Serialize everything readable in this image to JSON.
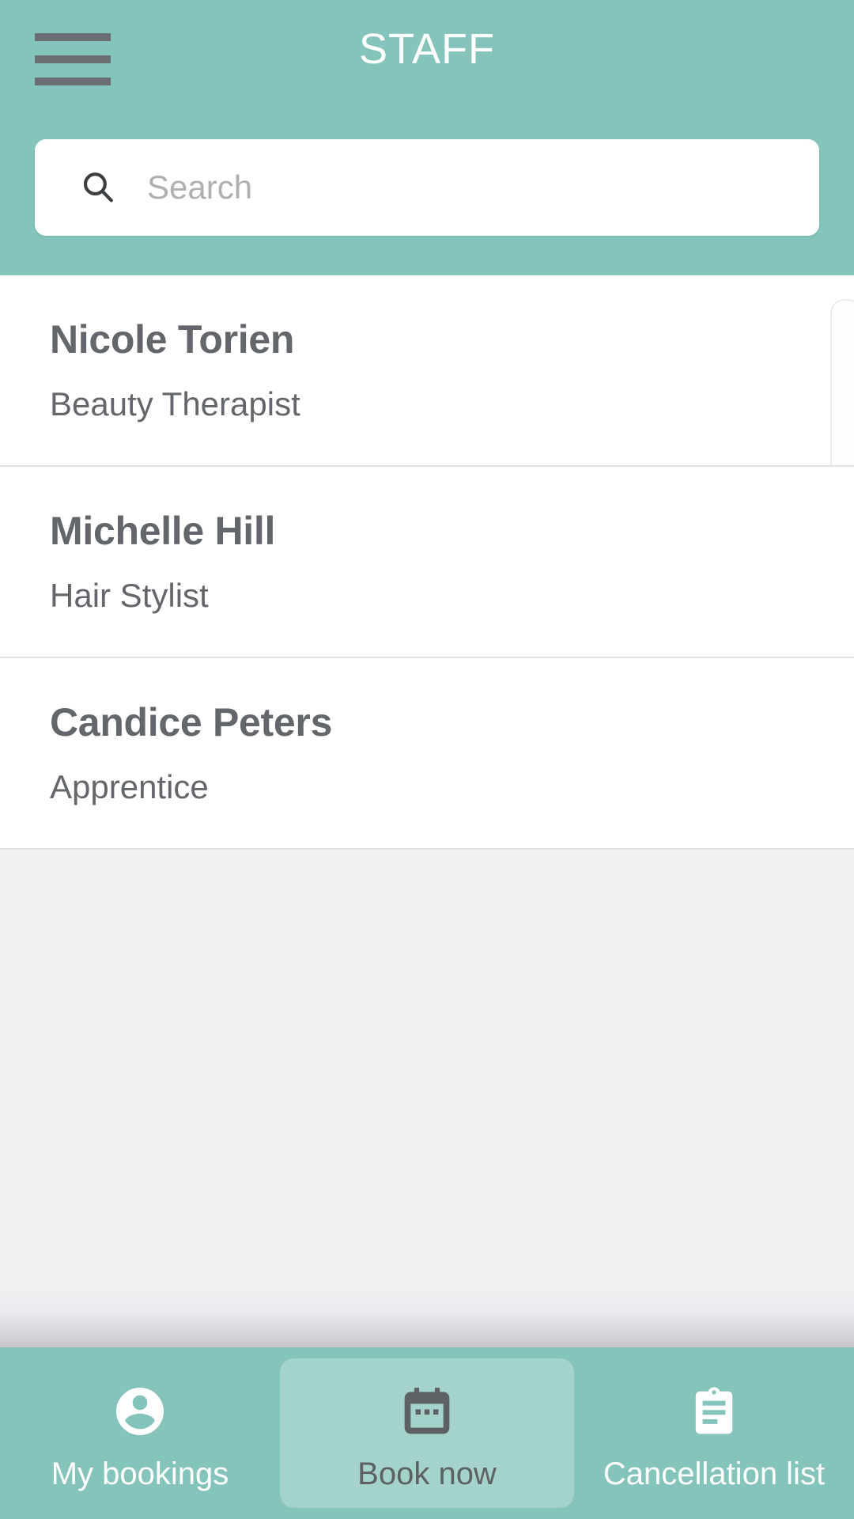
{
  "header": {
    "title": "STAFF",
    "menu_icon": "hamburger-menu-icon",
    "background_color": "#84c4bb"
  },
  "search": {
    "placeholder": "Search",
    "value": "",
    "icon": "search-icon"
  },
  "staff_list": [
    {
      "name": "Nicole Torien",
      "role": "Beauty Therapist"
    },
    {
      "name": "Michelle Hill",
      "role": "Hair Stylist"
    },
    {
      "name": "Candice Peters",
      "role": "Apprentice"
    }
  ],
  "bottom_nav": {
    "active_index": 1,
    "items": [
      {
        "label": "My bookings",
        "icon": "account-circle-icon",
        "active": false
      },
      {
        "label": "Book now",
        "icon": "calendar-icon",
        "active": true
      },
      {
        "label": "Cancellation list",
        "icon": "clipboard-list-icon",
        "active": false
      }
    ]
  },
  "colors": {
    "brand": "#84c4bb",
    "brand_light": "#a3d3cb",
    "text_primary": "#63666a",
    "page_background": "#f2f0f3"
  }
}
